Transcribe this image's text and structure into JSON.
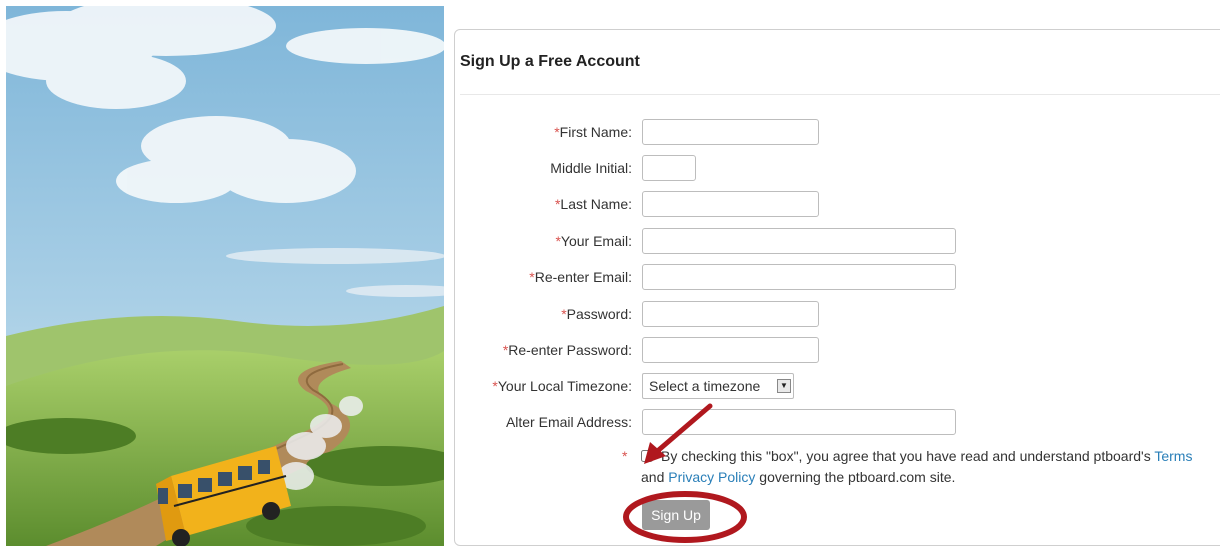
{
  "form": {
    "title": "Sign Up a Free Account",
    "fields": [
      {
        "label": "First Name:",
        "required": true,
        "value": ""
      },
      {
        "label": "Middle Initial:",
        "required": false,
        "value": ""
      },
      {
        "label": "Last Name:",
        "required": true,
        "value": ""
      },
      {
        "label": "Your Email:",
        "required": true,
        "value": ""
      },
      {
        "label": "Re-enter Email:",
        "required": true,
        "value": ""
      },
      {
        "label": "Password:",
        "required": true,
        "value": ""
      },
      {
        "label": "Re-enter Password:",
        "required": true,
        "value": ""
      },
      {
        "label": "Your Local Timezone:",
        "required": true,
        "value": "Select a timezone"
      },
      {
        "label": "Alter Email Address:",
        "required": false,
        "value": ""
      }
    ],
    "required_mark": "*",
    "agreement": {
      "text_before": "By checking this \"box\", you agree that you have read and understand ptboard's",
      "terms_link": "Terms",
      "and_text": "and",
      "privacy_link": "Privacy Policy",
      "text_after": "governing the ptboard.com site.",
      "checked": false
    },
    "signup_label": "Sign Up"
  },
  "colors": {
    "required_star": "#d9534f",
    "link": "#2a7fb8",
    "button_bg": "#9a9a9a",
    "annotation_red": "#b0181e"
  },
  "icons": {
    "dropdown": "dropdown-arrow-icon",
    "annotation_arrow": "red-arrow-icon",
    "annotation_circle": "red-ellipse-highlight"
  }
}
